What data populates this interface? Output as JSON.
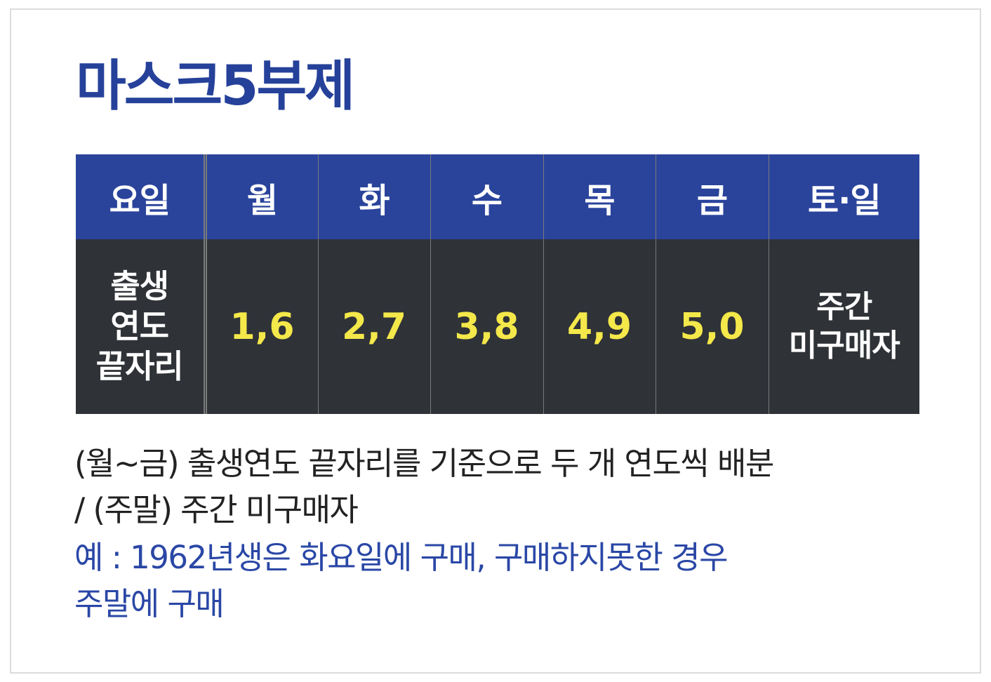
{
  "title": "마스크5부제",
  "colors": {
    "title": "#25419a",
    "header_bg": "#2a449c",
    "body_bg": "#2f3237",
    "digits": "#f4e84a",
    "note_dark": "#222222",
    "note_accent": "#2a47a6"
  },
  "table": {
    "header": {
      "label": "요일",
      "days": [
        "월",
        "화",
        "수",
        "목",
        "금",
        "토·일"
      ]
    },
    "row": {
      "label_lines": [
        "출생",
        "연도",
        "끝자리"
      ],
      "values": [
        "1,6",
        "2,7",
        "3,8",
        "4,9",
        "5,0"
      ],
      "weekend_lines": [
        "주간",
        "미구매자"
      ]
    }
  },
  "notes": {
    "line1": "(월~금) 출생연도 끝자리를 기준으로 두 개 연도씩 배분",
    "line2": "/ (주말) 주간 미구매자",
    "example_line1": "예 : 1962년생은 화요일에 구매, 구매하지못한 경우",
    "example_line2": "주말에 구매"
  }
}
